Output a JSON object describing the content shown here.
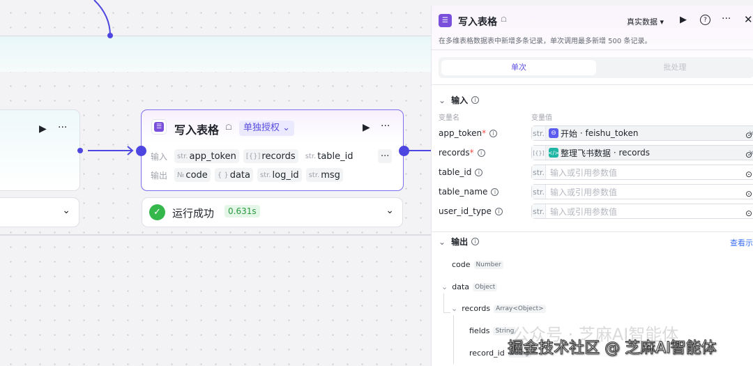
{
  "canvas": {
    "node": {
      "title": "写入表格",
      "auth": "单独授权",
      "input_label": "输入",
      "output_label": "输出",
      "inputs": [
        {
          "type": "str.",
          "name": "app_token"
        },
        {
          "type": "[{}]",
          "name": "records"
        },
        {
          "type": "str.",
          "name": "table_id"
        }
      ],
      "outputs": [
        {
          "type": "№",
          "name": "code"
        },
        {
          "type": "{ }",
          "name": "data"
        },
        {
          "type": "str.",
          "name": "log_id"
        },
        {
          "type": "str.",
          "name": "msg"
        }
      ],
      "more": "···"
    },
    "status": {
      "text": "运行成功",
      "time": "0.631s"
    }
  },
  "panel": {
    "title": "写入表格",
    "data_mode": "真实数据",
    "description": "在多维表格数据表中新增多条记录，单次调用最多新增 500 条记录。",
    "tabs": [
      "单次",
      "批处理"
    ],
    "input_section": "输入",
    "col_name": "变量名",
    "col_value": "变量值",
    "fields": [
      {
        "name": "app_token",
        "required": true,
        "type": "str.",
        "ref_node": "开始",
        "ref_var": "feishu_token",
        "ref_color": "#5b5bf0"
      },
      {
        "name": "records",
        "required": true,
        "type": "[{}]",
        "ref_node": "整理飞书数据",
        "ref_var": "records",
        "ref_color": "#1fb5a5"
      },
      {
        "name": "table_id",
        "required": false,
        "type": "str.",
        "placeholder": "输入或引用参数值"
      },
      {
        "name": "table_name",
        "required": false,
        "type": "str.",
        "placeholder": "输入或引用参数值"
      },
      {
        "name": "user_id_type",
        "required": false,
        "type": "str.",
        "placeholder": "输入或引用参数值"
      }
    ],
    "output_section": "输出",
    "view_example": "查看示例",
    "outputs": [
      {
        "name": "code",
        "type": "Number"
      },
      {
        "name": "data",
        "type": "Object"
      },
      {
        "name": "records",
        "type": "Array<Object>"
      },
      {
        "name": "fields",
        "type": "String"
      },
      {
        "name": "record_id",
        "type": "String"
      }
    ]
  },
  "watermark": {
    "line1": "公众号 · 芝麻AI智能体",
    "line2": "掘金技术社区 @ 芝麻AI智能体"
  }
}
